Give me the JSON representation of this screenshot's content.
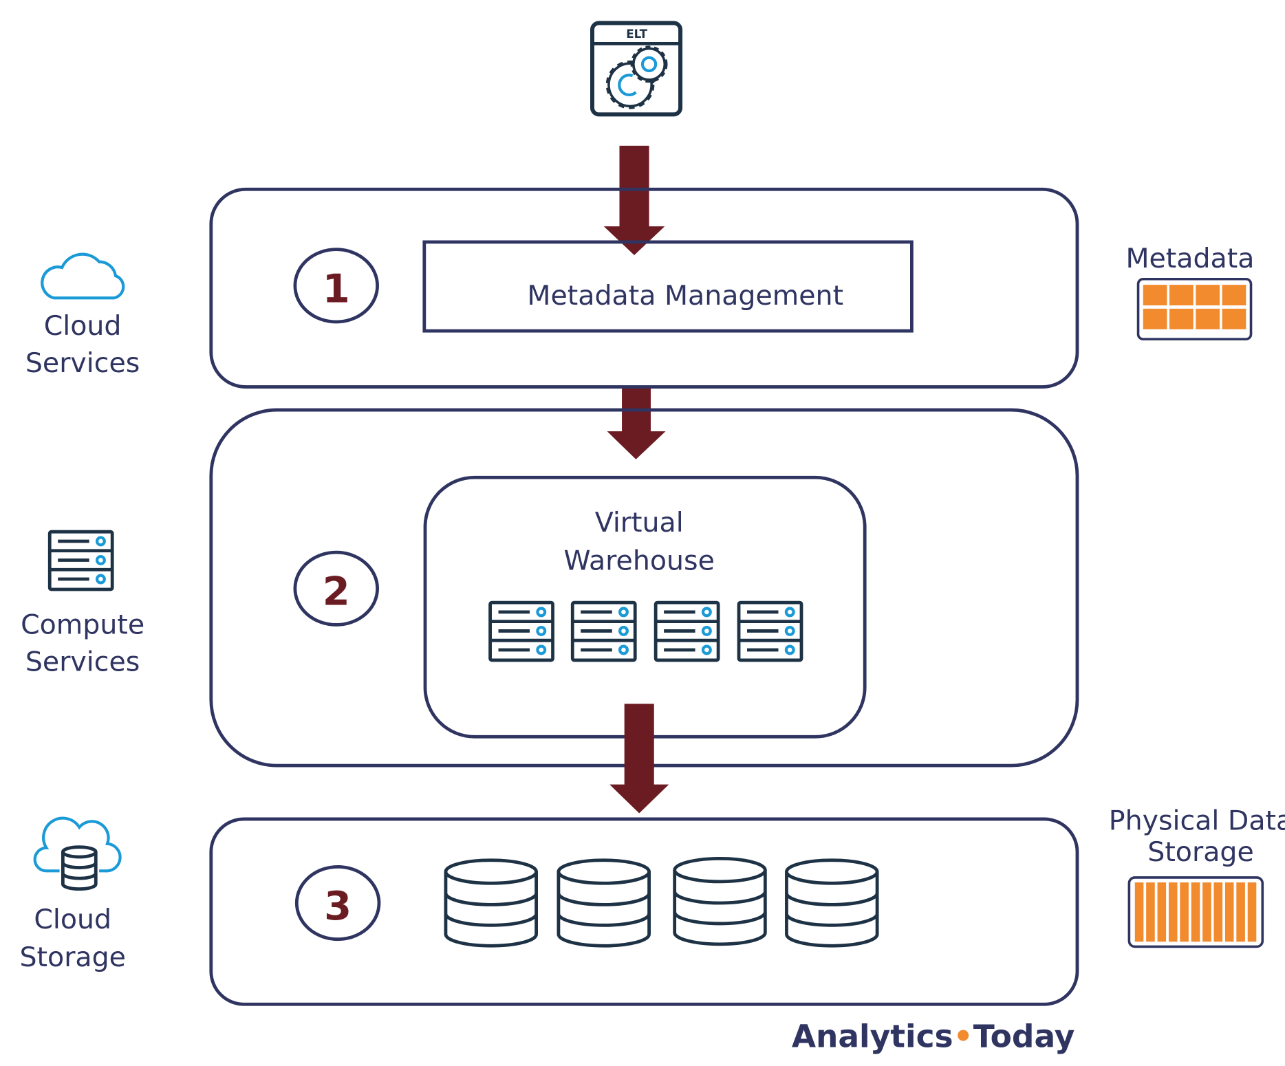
{
  "elt_icon": {
    "label": "ELT",
    "icon": "gears-icon"
  },
  "layers": [
    {
      "number": "1",
      "side_label": [
        "Cloud",
        "Services"
      ],
      "side_icon": "cloud-icon",
      "content": "Metadata Management"
    },
    {
      "number": "2",
      "side_label": [
        "Compute",
        "Services"
      ],
      "side_icon": "server-icon",
      "content": [
        "Virtual",
        "Warehouse"
      ]
    },
    {
      "number": "3",
      "side_label": [
        "Cloud",
        "Storage"
      ],
      "side_icon": "cloud-database-icon"
    }
  ],
  "right_labels": {
    "metadata": "Metadata",
    "physical": [
      "Physical Data",
      "Storage"
    ]
  },
  "logo": {
    "part1": "Analytics",
    "dot": "•",
    "part2": "Today"
  },
  "colors": {
    "navy": "#2f3461",
    "arrow": "#6b1c22",
    "orange": "#f28a2e",
    "icon_dark": "#1e3245",
    "icon_blue": "#1a9ad6"
  }
}
